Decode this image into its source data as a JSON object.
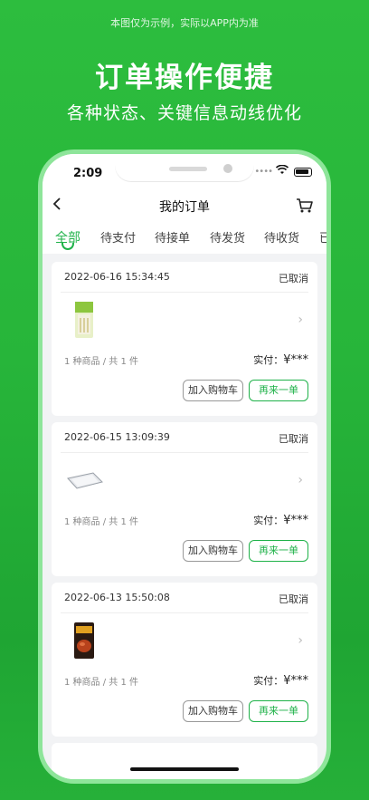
{
  "promo": {
    "disclaimer": "本图仅为示例，实际以APP内为准",
    "headline": "订单操作便捷",
    "subline": "各种状态、关键信息动线优化"
  },
  "status_bar": {
    "time": "2:09"
  },
  "header": {
    "title": "我的订单",
    "back_icon": "chevron-left-icon",
    "cart_icon": "cart-icon"
  },
  "tabs": [
    {
      "label": "全部",
      "active": true
    },
    {
      "label": "待支付"
    },
    {
      "label": "待接单"
    },
    {
      "label": "待发货"
    },
    {
      "label": "待收货"
    },
    {
      "label": "已"
    }
  ],
  "orders": [
    {
      "date": "2022-06-16 15:34:45",
      "status": "已取消",
      "product_icon": "noodle-package",
      "count": "1 种商品 / 共 1 件",
      "paid_label": "实付：",
      "paid_value": "¥***",
      "add_cart": "加入购物车",
      "reorder": "再来一单"
    },
    {
      "date": "2022-06-15 13:09:39",
      "status": "已取消",
      "product_icon": "tray",
      "count": "1 种商品 / 共 1 件",
      "paid_label": "实付：",
      "paid_value": "¥***",
      "add_cart": "加入购物车",
      "reorder": "再来一单"
    },
    {
      "date": "2022-06-13 15:50:08",
      "status": "已取消",
      "product_icon": "snack-bag",
      "count": "1 种商品 / 共 1 件",
      "paid_label": "实付：",
      "paid_value": "¥***",
      "add_cart": "加入购物车",
      "reorder": "再来一单"
    }
  ],
  "colors": {
    "accent": "#1fb249",
    "background": "#2dbd3e"
  }
}
